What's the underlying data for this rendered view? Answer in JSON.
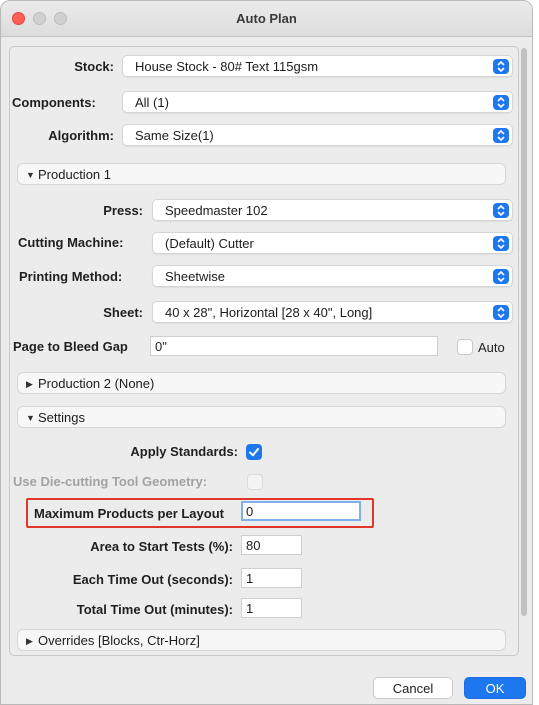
{
  "window": {
    "title": "Auto Plan"
  },
  "stock": {
    "label": "Stock:",
    "value": "House Stock - 80# Text 115gsm"
  },
  "components": {
    "label": "Components:",
    "value": "All (1)"
  },
  "algorithm": {
    "label": "Algorithm:",
    "value": "Same Size(1)"
  },
  "production1": {
    "header": "Production 1",
    "press": {
      "label": "Press:",
      "value": "Speedmaster 102"
    },
    "cutting_machine": {
      "label": "Cutting Machine:",
      "value": "(Default) Cutter"
    },
    "printing_method": {
      "label": "Printing Method:",
      "value": "Sheetwise"
    },
    "sheet": {
      "label": "Sheet:",
      "value": "40 x 28\", Horizontal [28 x 40\", Long]"
    },
    "page_to_bleed_gap": {
      "label": "Page to Bleed Gap",
      "value": "0\""
    },
    "auto": {
      "label": "Auto",
      "checked": false
    }
  },
  "production2": {
    "header": "Production 2  (None)"
  },
  "settings": {
    "header": "Settings",
    "apply_standards": {
      "label": "Apply Standards:",
      "checked": true
    },
    "die_cutting": {
      "label": "Use Die-cutting Tool Geometry:",
      "checked": false,
      "enabled": false
    },
    "max_products": {
      "label": "Maximum Products per Layout",
      "value": "0"
    },
    "area_to_start": {
      "label": "Area to Start Tests (%):",
      "value": "80"
    },
    "each_timeout": {
      "label": "Each Time Out (seconds):",
      "value": "1"
    },
    "total_timeout": {
      "label": "Total Time Out (minutes):",
      "value": "1"
    }
  },
  "overrides": {
    "header": "Overrides [Blocks, Ctr-Horz]"
  },
  "buttons": {
    "cancel": "Cancel",
    "ok": "OK"
  },
  "colors": {
    "accent": "#1d78f0",
    "highlight": "#e2362a"
  }
}
